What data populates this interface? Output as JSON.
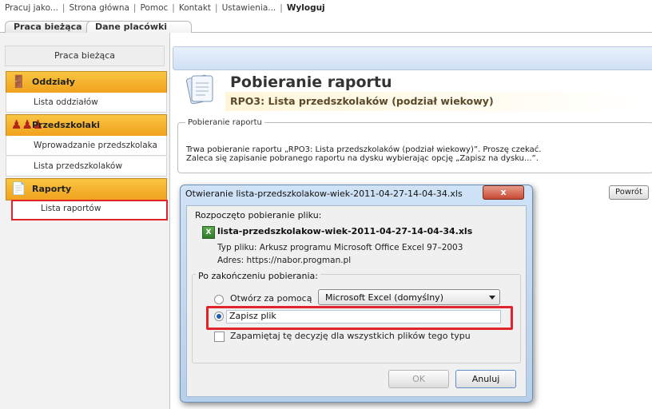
{
  "top_menu": {
    "items": [
      "Pracuj jako...",
      "Strona główna",
      "Pomoc",
      "Kontakt",
      "Ustawienia...",
      "Wyloguj"
    ]
  },
  "tabs": [
    "Praca bieżąca",
    "Dane placówki"
  ],
  "sidebar": {
    "title": "Praca bieżąca",
    "sections": [
      {
        "label": "Oddziały",
        "items": [
          "Lista oddziałów"
        ]
      },
      {
        "label": "Przedszkolaki",
        "items": [
          "Wprowadzanie przedszkolaka",
          "Lista przedszkolaków"
        ]
      },
      {
        "label": "Raporty",
        "items": [
          "Lista raportów"
        ]
      }
    ]
  },
  "main": {
    "title": "Pobieranie raportu",
    "subtitle": "RPO3: Lista przedszkolaków (podział wiekowy)",
    "fieldset_legend": "Pobieranie raportu",
    "message_line1": "Trwa pobieranie raportu „RPO3: Lista przedszkolaków (podział wiekowy)”. Proszę czekać.",
    "message_line2": "Zaleca się zapisanie pobranego raportu na dysku wybierając opcję „Zapisz na dysku...”.",
    "back_button": "Powrót"
  },
  "dialog": {
    "title": "Otwieranie lista-przedszkolakow-wiek-2011-04-27-14-04-34.xls",
    "close": "x",
    "started": "Rozpoczęto pobieranie pliku:",
    "filename": "lista-przedszkolakow-wiek-2011-04-27-14-04-34.xls",
    "file_type": "Typ pliku:  Arkusz programu Microsoft Office Excel 97–2003",
    "address": "Adres:  https://nabor.progman.pl",
    "after_legend": "Po zakończeniu pobierania:",
    "open_with_label": "Otwórz za pomocą",
    "open_with_value": "Microsoft Excel (domyślny)",
    "save_label": "Zapisz plik",
    "remember_label": "Zapamiętaj tę decyzję dla wszystkich plików tego typu",
    "ok": "OK",
    "cancel": "Anuluj",
    "selected_option": "save"
  }
}
